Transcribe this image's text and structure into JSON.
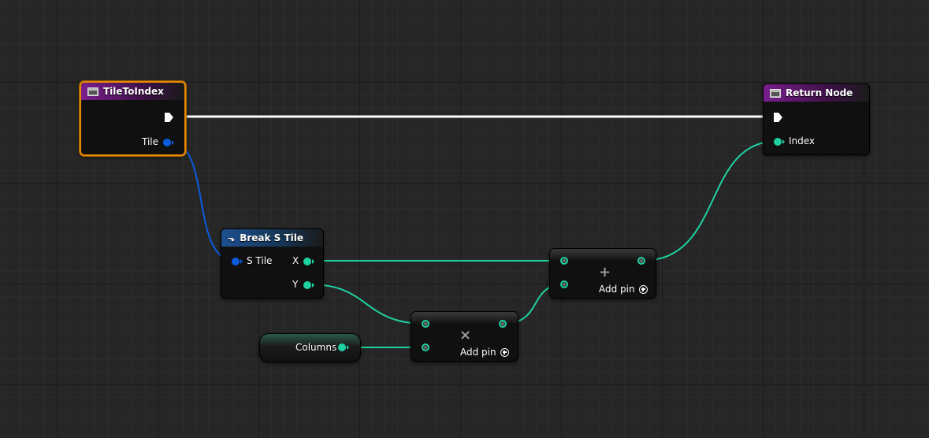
{
  "nodes": {
    "tile_to_index": {
      "title": "TileToIndex",
      "pin_tile": "Tile"
    },
    "return_node": {
      "title": "Return Node",
      "pin_index": "Index"
    },
    "break_s_tile": {
      "title": "Break S Tile",
      "pin_s_tile": "S Tile",
      "pin_x": "X",
      "pin_y": "Y"
    },
    "columns": {
      "label": "Columns"
    },
    "multiply": {
      "operator": "×",
      "add_pin": "Add pin"
    },
    "add": {
      "operator": "+",
      "add_pin": "Add pin"
    }
  },
  "colors": {
    "background": "#262626",
    "exec_wire": "#ffffff",
    "struct_wire": "#0b5ce0",
    "int_wire": "#1ed1a0",
    "selection": "#e68a00",
    "function_header": "#7a1e8c",
    "break_header": "#1d4f8f"
  }
}
